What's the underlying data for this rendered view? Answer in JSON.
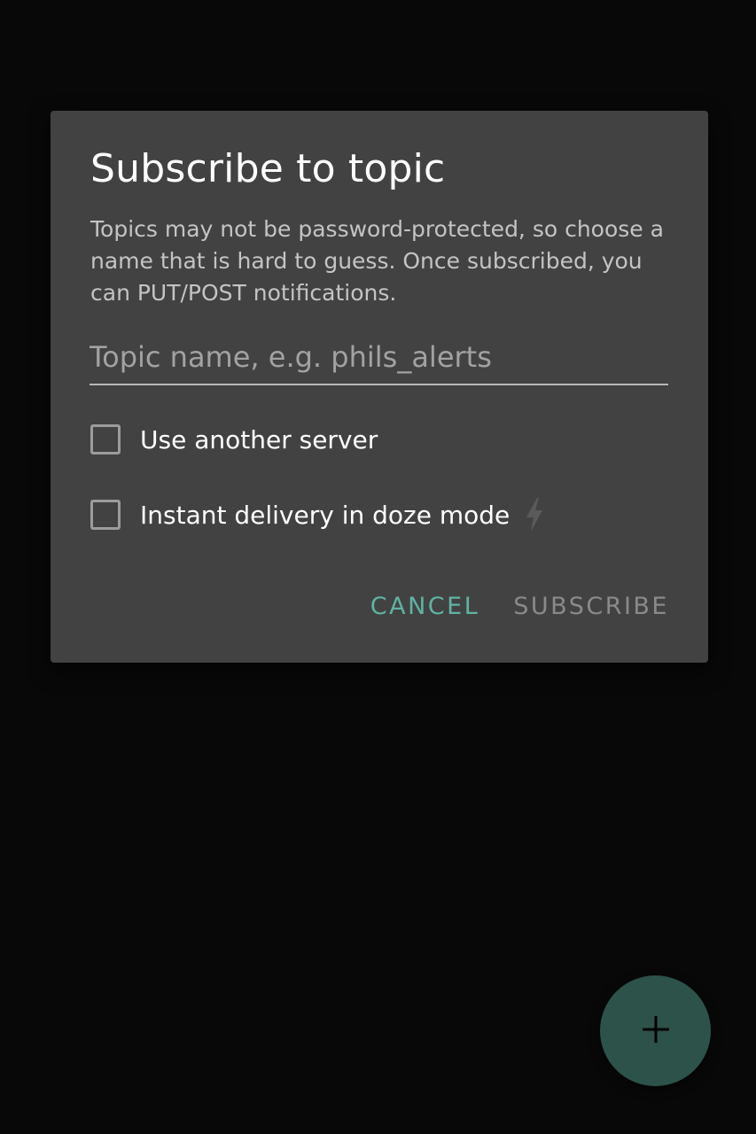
{
  "dialog": {
    "title": "Subscribe to topic",
    "description": "Topics may not be password-protected, so choose a name that is hard to guess. Once subscribed, you can PUT/POST notifications.",
    "topic_input": {
      "value": "",
      "placeholder": "Topic name, e.g. phils_alerts"
    },
    "options": {
      "use_another_server": {
        "label": "Use another server",
        "checked": false
      },
      "instant_delivery": {
        "label": "Instant delivery in doze mode",
        "checked": false,
        "icon": "bolt-icon"
      }
    },
    "buttons": {
      "cancel": "CANCEL",
      "subscribe": "SUBSCRIBE"
    }
  },
  "fab": {
    "icon": "plus-icon"
  },
  "colors": {
    "background": "#080808",
    "dialog_bg": "#424242",
    "accent": "#5fb3a3",
    "fab_bg": "#2c524a",
    "disabled_text": "#8a8a8a"
  }
}
